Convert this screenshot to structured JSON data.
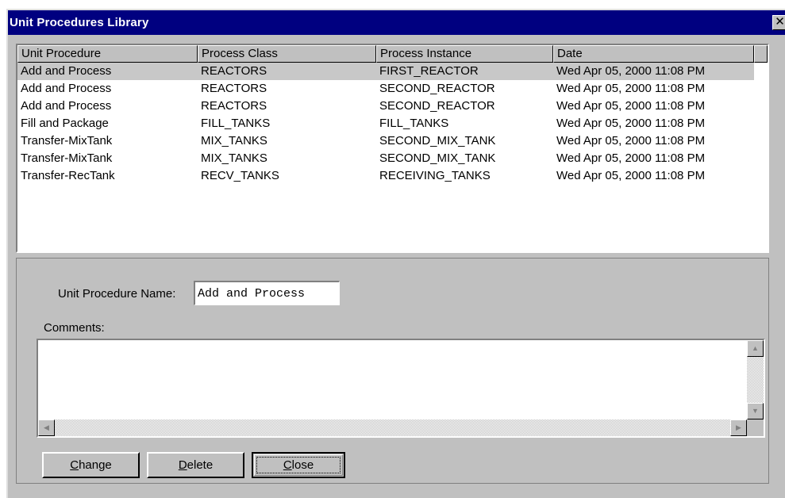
{
  "window": {
    "title": "Unit Procedures Library",
    "close_glyph": "✕"
  },
  "list": {
    "columns": [
      "Unit Procedure",
      "Process Class",
      "Process Instance",
      "Date"
    ],
    "rows": [
      [
        "Add and Process",
        "REACTORS",
        "FIRST_REACTOR",
        "Wed Apr 05, 2000  11:08 PM"
      ],
      [
        "Add and Process",
        "REACTORS",
        "SECOND_REACTOR",
        "Wed Apr 05, 2000  11:08 PM"
      ],
      [
        "Add and Process",
        "REACTORS",
        "SECOND_REACTOR",
        "Wed Apr 05, 2000  11:08 PM"
      ],
      [
        "Fill and Package",
        "FILL_TANKS",
        "FILL_TANKS",
        "Wed Apr 05, 2000  11:08 PM"
      ],
      [
        "Transfer-MixTank",
        "MIX_TANKS",
        "SECOND_MIX_TANK",
        "Wed Apr 05, 2000  11:08 PM"
      ],
      [
        "Transfer-MixTank",
        "MIX_TANKS",
        "SECOND_MIX_TANK",
        "Wed Apr 05, 2000  11:08 PM"
      ],
      [
        "Transfer-RecTank",
        "RECV_TANKS",
        "RECEIVING_TANKS",
        "Wed Apr 05, 2000  11:08 PM"
      ]
    ],
    "selected_row": 0
  },
  "form": {
    "name_label": "Unit Procedure Name:",
    "name_value": "Add and Process",
    "comments_label": "Comments:",
    "comments_value": ""
  },
  "buttons": {
    "change": {
      "mnemonic": "C",
      "rest": "hange"
    },
    "delete": {
      "mnemonic": "D",
      "rest": "elete"
    },
    "close": {
      "mnemonic": "C",
      "rest": "lose"
    }
  },
  "icons": {
    "window_close": "close-icon",
    "scroll_up": "arrow-up-icon",
    "scroll_down": "arrow-down-icon",
    "scroll_left": "arrow-left-icon",
    "scroll_right": "arrow-right-icon"
  },
  "colors": {
    "titlebar": "#000080",
    "face": "#c0c0c0",
    "selection": "#c8c8c8"
  }
}
